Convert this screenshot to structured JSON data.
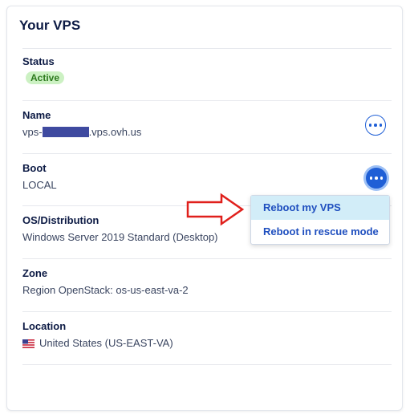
{
  "card": {
    "title": "Your VPS"
  },
  "status": {
    "label": "Status",
    "badge": "Active"
  },
  "name": {
    "label": "Name",
    "value_prefix": "vps-",
    "value_suffix": ".vps.ovh.us"
  },
  "boot": {
    "label": "Boot",
    "value": "LOCAL"
  },
  "os": {
    "label": "OS/Distribution",
    "value": "Windows Server 2019 Standard (Desktop)"
  },
  "zone": {
    "label": "Zone",
    "value": "Region OpenStack: os-us-east-va-2"
  },
  "location": {
    "label": "Location",
    "value": "United States (US-EAST-VA)",
    "flag_icon": "us-flag-icon"
  },
  "boot_menu": {
    "items": [
      {
        "label": "Reboot my VPS",
        "highlighted": true
      },
      {
        "label": "Reboot in rescue mode",
        "highlighted": false
      }
    ]
  },
  "colors": {
    "accent": "#1f5fd6",
    "badge_bg": "#ccf1c3",
    "badge_text": "#2d7a1e",
    "annotation_arrow": "#e0201c"
  },
  "icons": {
    "more": "more-options-icon",
    "arrow": "annotation-arrow-icon"
  }
}
